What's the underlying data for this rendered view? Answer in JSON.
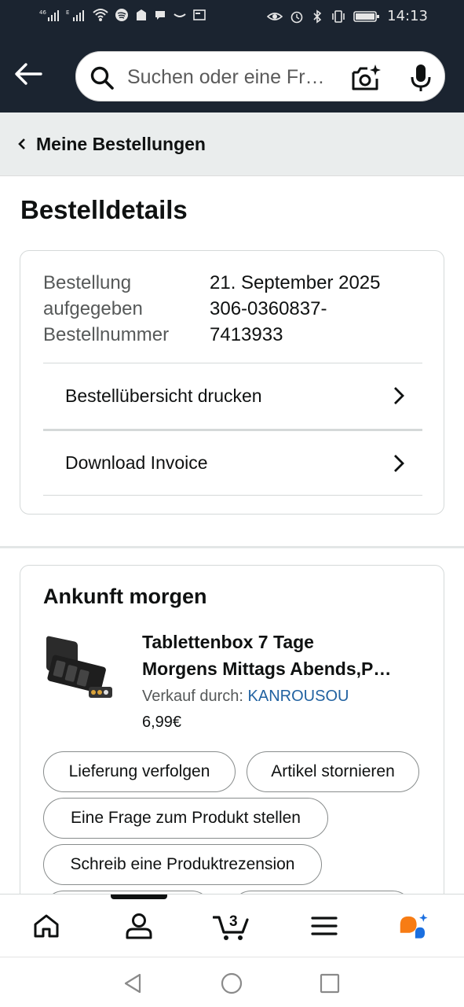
{
  "status_bar": {
    "left_text": "46 E",
    "time": "14:13"
  },
  "header": {
    "search_placeholder": "Suchen oder eine Fr…",
    "icons": [
      "back-arrow-icon",
      "search-icon",
      "camera-lens-icon",
      "microphone-icon"
    ]
  },
  "breadcrumb": {
    "label": "Meine Bestellungen"
  },
  "page": {
    "title": "Bestelldetails"
  },
  "order": {
    "placed_label_1": "Bestellung",
    "placed_label_2": "aufgegeben",
    "placed_value": "21. September 2025",
    "number_label": "Bestellnummer",
    "number_value_1": "306-0360837-",
    "number_value_2": "7413933",
    "actions": [
      {
        "label": "Bestellübersicht drucken"
      },
      {
        "label": "Download Invoice"
      }
    ]
  },
  "shipment": {
    "title": "Ankunft morgen",
    "product": {
      "title_line1": "Tablettenbox 7 Tage",
      "title_line2": "Morgens Mittags Abends,P…",
      "seller_label": "Verkauf durch:",
      "seller_name": "KANROUSOU",
      "price": "6,99€"
    },
    "buttons": [
      {
        "label": "Lieferung verfolgen"
      },
      {
        "label": "Artikel stornieren"
      },
      {
        "label": "Eine Frage zum Produkt stellen"
      },
      {
        "label": "Schreib eine Produktrezension"
      },
      {
        "label": ""
      },
      {
        "label": ""
      }
    ]
  },
  "bottom_nav": {
    "cart_count": "3",
    "items": [
      "home-icon",
      "account-icon",
      "cart-icon",
      "menu-icon",
      "rufus-icon"
    ]
  },
  "colors": {
    "header_bg": "#1b2430",
    "link": "#2162a1",
    "breadcrumb_bg": "#eaeded",
    "rufus_orange": "#f77c14",
    "rufus_blue": "#1a6fe0"
  }
}
